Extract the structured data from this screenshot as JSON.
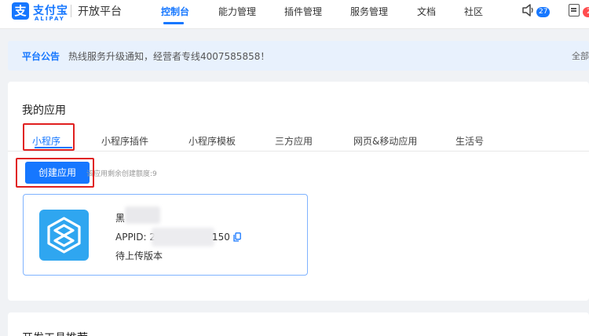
{
  "header": {
    "logo_glyph": "支",
    "logo_cn": "支付宝",
    "logo_en": "ALIPAY",
    "platform": "开放平台",
    "nav": [
      "控制台",
      "能力管理",
      "插件管理",
      "服务管理",
      "文档",
      "社区"
    ],
    "active_nav": "控制台",
    "message_count": "27",
    "todo_count": "2"
  },
  "notice": {
    "title": "平台公告",
    "text": "热线服务升级通知，经营者专线4007585858！",
    "more": "全部"
  },
  "apps": {
    "title": "我的应用",
    "tabs": [
      "小程序",
      "小程序插件",
      "小程序模板",
      "三方应用",
      "网页&移动应用",
      "生活号"
    ],
    "create_button": "创建应用",
    "quota_text": "该应用剩余创建额度:9",
    "app": {
      "name": "黑",
      "appid_prefix": "APPID: 2",
      "appid_suffix": "150",
      "status": "待上传版本"
    }
  },
  "tools": {
    "title": "开发工具推荐"
  },
  "colors": {
    "accent": "#1677ff",
    "highlight_box": "#e02020",
    "app_icon": "#2fa6f0"
  }
}
